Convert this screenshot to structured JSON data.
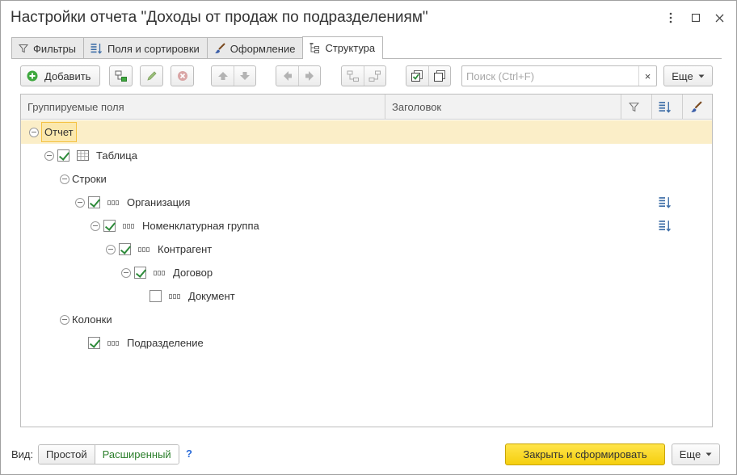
{
  "window": {
    "title": "Настройки отчета \"Доходы от продаж по подразделениям\"",
    "more_icon": "vertical-dots-icon",
    "maximize_icon": "maximize-icon",
    "close_icon": "close-icon"
  },
  "tabs": [
    {
      "label": "Фильтры",
      "icon": "filter-icon",
      "active": false
    },
    {
      "label": "Поля и сортировки",
      "icon": "sort-fields-icon",
      "active": false
    },
    {
      "label": "Оформление",
      "icon": "brush-icon",
      "active": false
    },
    {
      "label": "Структура",
      "icon": "structure-icon",
      "active": true
    }
  ],
  "toolbar": {
    "add_label": "Добавить",
    "search_placeholder": "Поиск (Ctrl+F)",
    "search_clear": "×",
    "more_label": "Еще"
  },
  "grid": {
    "columns": [
      "Группируемые поля",
      "Заголовок"
    ],
    "rows": [
      {
        "label": "Отчет",
        "level": 0,
        "toggle": true,
        "checkbox": null,
        "icon": null,
        "selected": true,
        "sort_icon": false
      },
      {
        "label": "Таблица",
        "level": 1,
        "toggle": true,
        "checkbox": true,
        "icon": "table-icon",
        "selected": false,
        "sort_icon": false
      },
      {
        "label": "Строки",
        "level": 2,
        "toggle": true,
        "checkbox": null,
        "icon": null,
        "selected": false,
        "sort_icon": false
      },
      {
        "label": "Организация",
        "level": 3,
        "toggle": true,
        "checkbox": true,
        "icon": "field-icon",
        "selected": false,
        "sort_icon": true
      },
      {
        "label": "Номенклатурная группа",
        "level": 4,
        "toggle": true,
        "checkbox": true,
        "icon": "field-icon",
        "selected": false,
        "sort_icon": true
      },
      {
        "label": "Контрагент",
        "level": 5,
        "toggle": true,
        "checkbox": true,
        "icon": "field-icon",
        "selected": false,
        "sort_icon": false
      },
      {
        "label": "Договор",
        "level": 6,
        "toggle": true,
        "checkbox": true,
        "icon": "field-icon",
        "selected": false,
        "sort_icon": false
      },
      {
        "label": "Документ",
        "level": 7,
        "toggle": false,
        "checkbox": false,
        "icon": "field-icon",
        "selected": false,
        "sort_icon": false
      },
      {
        "label": "Колонки",
        "level": 2,
        "toggle": true,
        "checkbox": null,
        "icon": null,
        "selected": false,
        "sort_icon": false
      },
      {
        "label": "Подразделение",
        "level": 3,
        "toggle": false,
        "checkbox": true,
        "icon": "field-icon",
        "selected": false,
        "sort_icon": false
      }
    ]
  },
  "footer": {
    "view_label": "Вид:",
    "view_simple": "Простой",
    "view_extended": "Расширенный",
    "help": "?",
    "primary_label": "Закрыть и сформировать",
    "more_label": "Еще"
  },
  "colors": {
    "primary": "#f5cf0e",
    "selected_row": "#fbeec8",
    "checkmark": "#2e8b3a",
    "active_view": "#2a7e2a",
    "help": "#2a6bd8"
  }
}
